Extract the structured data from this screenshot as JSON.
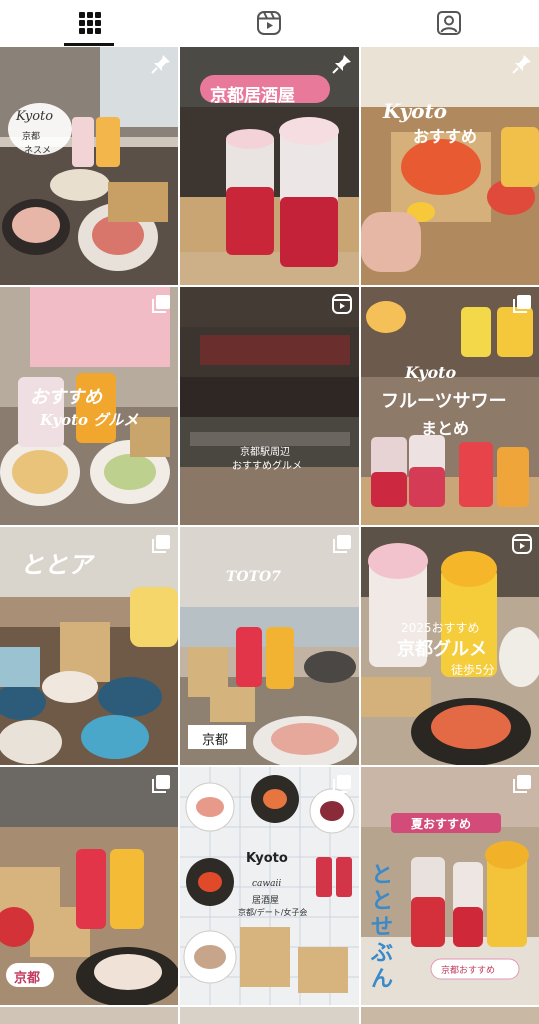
{
  "tabs": [
    {
      "icon": "grid-icon",
      "selected": true
    },
    {
      "icon": "reels-icon",
      "selected": false
    },
    {
      "icon": "tagged-user-icon",
      "selected": false
    }
  ],
  "posts": [
    {
      "badge": "pin-icon",
      "texts": [
        "Kyoto",
        "京都",
        "ネスメ"
      ]
    },
    {
      "badge": "pin-icon",
      "texts": [
        "京都居酒屋"
      ]
    },
    {
      "badge": "pin-icon",
      "texts": [
        "Kyoto",
        "おすすめ"
      ]
    },
    {
      "badge": "carousel-icon",
      "texts": [
        "おすすめ",
        "Kyoto グルメ"
      ]
    },
    {
      "badge": "reel-icon",
      "texts": [
        "京都駅周辺",
        "おすすめグルメ"
      ]
    },
    {
      "badge": "carousel-icon",
      "texts": [
        "Kyoto",
        "フルーツサワー",
        "まとめ"
      ]
    },
    {
      "badge": "carousel-icon",
      "texts": [
        "ととア"
      ]
    },
    {
      "badge": "carousel-icon",
      "texts": [
        "TOTO7",
        "京都"
      ]
    },
    {
      "badge": "reel-icon",
      "texts": [
        "2025おすすめ",
        "京都グルメ",
        "徒歩5分"
      ]
    },
    {
      "badge": "carousel-icon",
      "texts": [
        "京都"
      ]
    },
    {
      "badge": "carousel-icon",
      "texts": [
        "Kyoto",
        "cawaii",
        "居酒屋",
        "京都/デート/女子会"
      ]
    },
    {
      "badge": "carousel-icon",
      "texts": [
        "夏おすすめ",
        "ととせぶん",
        "京都おすすめ"
      ]
    }
  ]
}
